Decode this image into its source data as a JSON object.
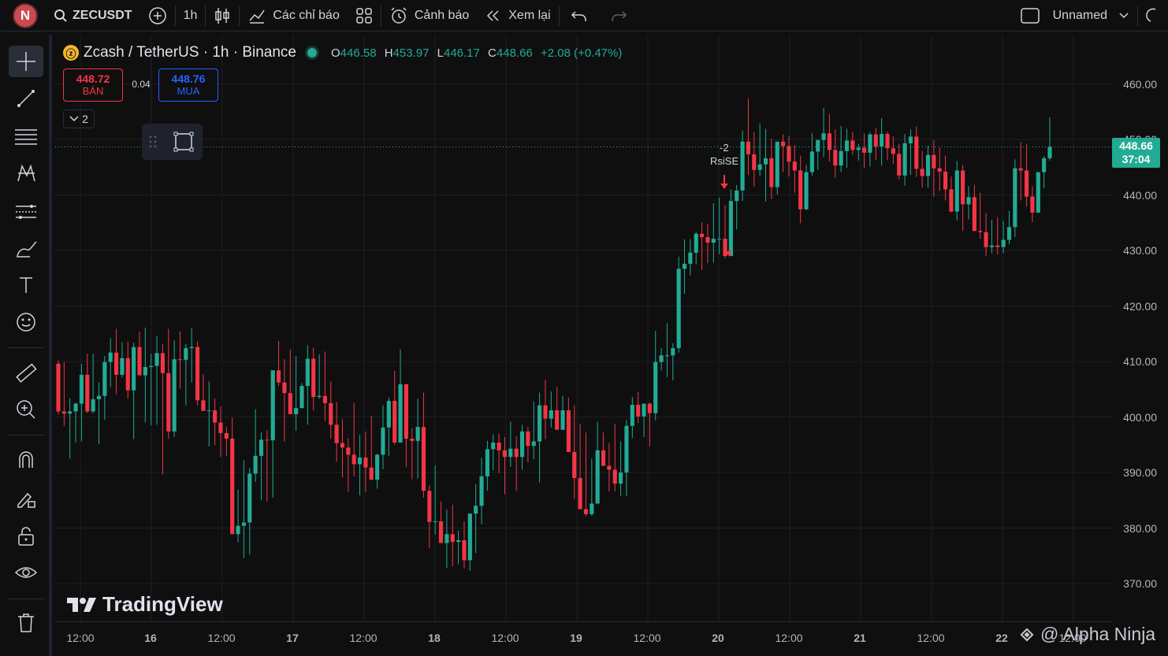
{
  "topbar": {
    "avatar_letter": "N",
    "symbol": "ZECUSDT",
    "interval": "1h",
    "indicators_label": "Các chỉ báo",
    "alerts_label": "Cảnh báo",
    "replay_label": "Xem lại",
    "layout_name": "Unnamed"
  },
  "legend": {
    "title": "Zcash / TetherUS · 1h · Binance",
    "coin_glyph": "ⓩ",
    "o_key": "O",
    "o_val": "446.58",
    "h_key": "H",
    "h_val": "453.97",
    "l_key": "L",
    "l_val": "446.17",
    "c_key": "C",
    "c_val": "448.66",
    "change": "+2.08 (+0.47%)"
  },
  "trade": {
    "sell_price": "448.72",
    "sell_label": "BÁN",
    "spread": "0.04",
    "buy_price": "448.76",
    "buy_label": "MUA",
    "collapse_count": "2"
  },
  "signal": {
    "value": "-2",
    "label": "RsiSE"
  },
  "price_axis": {
    "labels": [
      "460.00",
      "450.00",
      "440.00",
      "430.00",
      "420.00",
      "410.00",
      "400.00",
      "390.00",
      "380.00",
      "370.00"
    ],
    "last_price": "448.66",
    "countdown": "37:04"
  },
  "time_axis": {
    "labels": [
      "12:00",
      "16",
      "12:00",
      "17",
      "12:00",
      "18",
      "12:00",
      "19",
      "12:00",
      "20",
      "12:00",
      "21",
      "12:00",
      "22",
      "12:00"
    ]
  },
  "branding": {
    "logo": "TradingView",
    "watermark": "@ Alpha Ninja"
  },
  "colors": {
    "up": "#22ab94",
    "down": "#f23645",
    "background": "#0f0f0f",
    "grid": "#1c1f26"
  },
  "chart_data": {
    "type": "candlestick",
    "symbol": "ZECUSDT",
    "interval": "1h",
    "ylim": [
      365,
      465
    ],
    "ohlc": [
      [
        409.6,
        410.2,
        400.5,
        401.0
      ],
      [
        401.0,
        409.9,
        398.4,
        400.6
      ],
      [
        400.6,
        403.4,
        392.5,
        401.0
      ],
      [
        401.0,
        402.6,
        395.4,
        402.4
      ],
      [
        402.4,
        409.6,
        395.6,
        407.6
      ],
      [
        407.6,
        411.4,
        400.7,
        401.0
      ],
      [
        401.0,
        411.4,
        400.7,
        403.2
      ],
      [
        403.2,
        406.2,
        395.1,
        403.8
      ],
      [
        403.8,
        411.0,
        399.5,
        409.9
      ],
      [
        409.9,
        414.2,
        405.4,
        411.6
      ],
      [
        411.6,
        415.9,
        404.1,
        407.6
      ],
      [
        407.6,
        413.5,
        407.1,
        410.6
      ],
      [
        410.6,
        413.6,
        403.3,
        404.8
      ],
      [
        404.8,
        413.4,
        396.0,
        412.6
      ],
      [
        412.6,
        415.4,
        407.8,
        407.5
      ],
      [
        407.5,
        416.1,
        399.0,
        409.0
      ],
      [
        409.0,
        411.4,
        398.5,
        409.2
      ],
      [
        409.2,
        414.6,
        398.6,
        411.5
      ],
      [
        411.5,
        413.1,
        389.7,
        407.9
      ],
      [
        407.9,
        415.9,
        396.1,
        397.4
      ],
      [
        397.4,
        413.8,
        396.4,
        410.4
      ],
      [
        410.4,
        415.4,
        405.1,
        410.3
      ],
      [
        410.3,
        413.2,
        402.1,
        412.4
      ],
      [
        412.4,
        416.1,
        406.2,
        412.6
      ],
      [
        412.6,
        413.6,
        402.1,
        403.0
      ],
      [
        403.0,
        407.7,
        401.6,
        401.1
      ],
      [
        401.1,
        406.4,
        394.7,
        401.2
      ],
      [
        401.2,
        403.3,
        394.9,
        399.0
      ],
      [
        399.0,
        401.9,
        392.8,
        397.1
      ],
      [
        397.1,
        398.2,
        393.0,
        396.1
      ],
      [
        396.1,
        399.9,
        384.8,
        378.9
      ],
      [
        378.9,
        386.9,
        377.4,
        380.4
      ],
      [
        380.4,
        392.2,
        374.6,
        381.0
      ],
      [
        381.0,
        390.8,
        375.2,
        389.8
      ],
      [
        389.8,
        401.4,
        388.3,
        393.0
      ],
      [
        393.0,
        397.2,
        385.0,
        395.9
      ],
      [
        395.9,
        397.6,
        384.8,
        395.8
      ],
      [
        395.8,
        405.3,
        385.5,
        408.4
      ],
      [
        408.4,
        413.7,
        405.6,
        406.2
      ],
      [
        406.2,
        410.4,
        395.6,
        404.3
      ],
      [
        404.3,
        412.2,
        405.0,
        400.5
      ],
      [
        400.5,
        411.0,
        397.5,
        401.6
      ],
      [
        401.6,
        406.1,
        403.3,
        405.6
      ],
      [
        405.6,
        412.9,
        398.6,
        410.5
      ],
      [
        410.5,
        412.5,
        401.2,
        403.6
      ],
      [
        403.6,
        411.3,
        403.3,
        403.8
      ],
      [
        403.8,
        411.8,
        399.3,
        402.5
      ],
      [
        402.5,
        406.4,
        396.1,
        398.6
      ],
      [
        398.6,
        402.7,
        392.0,
        395.3
      ],
      [
        395.3,
        399.6,
        389.1,
        394.5
      ],
      [
        394.5,
        396.2,
        386.5,
        393.2
      ],
      [
        393.2,
        402.6,
        389.3,
        391.5
      ],
      [
        391.5,
        396.8,
        385.9,
        392.7
      ],
      [
        392.7,
        397.4,
        386.5,
        390.9
      ],
      [
        390.9,
        400.2,
        388.8,
        388.7
      ],
      [
        388.7,
        393.4,
        387.1,
        393.2
      ],
      [
        393.2,
        402.1,
        390.6,
        398.1
      ],
      [
        398.1,
        403.5,
        393.0,
        402.9
      ],
      [
        402.9,
        408.3,
        395.0,
        395.4
      ],
      [
        395.4,
        412.2,
        395.4,
        405.9
      ],
      [
        405.9,
        405.4,
        391.0,
        396.1
      ],
      [
        396.1,
        398.0,
        388.8,
        395.7
      ],
      [
        395.7,
        403.3,
        388.9,
        398.2
      ],
      [
        398.2,
        404.4,
        385.5,
        386.7
      ],
      [
        386.7,
        387.7,
        376.4,
        381.1
      ],
      [
        381.1,
        391.3,
        378.8,
        381.2
      ],
      [
        381.2,
        384.8,
        377.8,
        377.3
      ],
      [
        377.3,
        383.3,
        372.8,
        378.9
      ],
      [
        378.9,
        384.2,
        373.1,
        377.5
      ],
      [
        377.5,
        379.5,
        373.5,
        377.8
      ],
      [
        377.8,
        381.2,
        372.7,
        374.2
      ],
      [
        374.2,
        381.0,
        372.3,
        382.6
      ],
      [
        382.6,
        387.9,
        375.5,
        384.0
      ],
      [
        384.0,
        392.6,
        380.7,
        389.3
      ],
      [
        389.3,
        395.7,
        386.7,
        394.2
      ],
      [
        394.2,
        396.9,
        390.4,
        395.4
      ],
      [
        395.4,
        397.0,
        389.9,
        394.0
      ],
      [
        394.0,
        396.4,
        386.1,
        392.8
      ],
      [
        392.8,
        399.2,
        391.0,
        394.3
      ],
      [
        394.3,
        396.5,
        386.7,
        392.8
      ],
      [
        392.8,
        398.6,
        390.5,
        397.4
      ],
      [
        397.4,
        398.2,
        391.9,
        394.8
      ],
      [
        394.8,
        402.8,
        392.4,
        395.6
      ],
      [
        395.6,
        404.4,
        388.2,
        402.1
      ],
      [
        402.1,
        406.7,
        396.0,
        399.7
      ],
      [
        399.7,
        404.6,
        398.1,
        401.2
      ],
      [
        401.2,
        405.4,
        398.4,
        397.7
      ],
      [
        397.7,
        403.8,
        398.0,
        401.2
      ],
      [
        401.2,
        403.5,
        396.9,
        393.7
      ],
      [
        393.7,
        402.1,
        385.2,
        389.0
      ],
      [
        389.0,
        398.8,
        384.2,
        383.4
      ],
      [
        383.4,
        397.2,
        382.1,
        382.5
      ],
      [
        382.5,
        392.5,
        382.2,
        384.4
      ],
      [
        384.4,
        399.2,
        384.6,
        394.0
      ],
      [
        394.0,
        397.2,
        391.6,
        391.2
      ],
      [
        391.2,
        395.3,
        386.6,
        390.5
      ],
      [
        390.5,
        398.8,
        386.6,
        388.0
      ],
      [
        388.0,
        395.6,
        385.8,
        390.0
      ],
      [
        390.0,
        399.5,
        385.7,
        398.4
      ],
      [
        398.4,
        403.6,
        396.2,
        402.2
      ],
      [
        402.2,
        404.5,
        398.9,
        400.1
      ],
      [
        400.1,
        400.1,
        396.4,
        402.4
      ],
      [
        402.4,
        402.6,
        394.7,
        400.7
      ],
      [
        400.7,
        415.5,
        399.4,
        409.9
      ],
      [
        409.9,
        412.4,
        408.4,
        411.1
      ],
      [
        411.1,
        416.9,
        407.2,
        411.1
      ],
      [
        411.1,
        413.3,
        406.6,
        412.4
      ],
      [
        412.4,
        428.9,
        411.6,
        426.7
      ],
      [
        426.7,
        432.0,
        422.2,
        427.6
      ],
      [
        427.6,
        432.0,
        425.5,
        429.6
      ],
      [
        429.6,
        433.3,
        427.5,
        433.0
      ],
      [
        433.0,
        435.1,
        426.5,
        432.4
      ],
      [
        432.4,
        434.8,
        427.7,
        431.4
      ],
      [
        431.4,
        438.5,
        427.8,
        432.1
      ],
      [
        432.1,
        439.5,
        429.3,
        432.1
      ],
      [
        432.1,
        438.2,
        428.6,
        429.0
      ],
      [
        429.0,
        441.0,
        431.3,
        438.9
      ],
      [
        438.9,
        441.8,
        433.8,
        440.8
      ],
      [
        440.8,
        451.6,
        438.9,
        449.6
      ],
      [
        449.6,
        457.4,
        443.6,
        447.3
      ],
      [
        447.3,
        451.3,
        441.5,
        444.5
      ],
      [
        444.5,
        452.9,
        443.4,
        445.5
      ],
      [
        445.5,
        451.9,
        438.8,
        446.6
      ],
      [
        446.6,
        450.1,
        439.3,
        441.4
      ],
      [
        441.4,
        449.6,
        440.1,
        449.6
      ],
      [
        449.6,
        450.9,
        444.1,
        448.8
      ],
      [
        448.8,
        450.6,
        443.3,
        446.0
      ],
      [
        446.0,
        449.0,
        440.4,
        444.4
      ],
      [
        444.4,
        447.1,
        434.9,
        437.4
      ],
      [
        437.4,
        445.4,
        437.3,
        444.1
      ],
      [
        444.1,
        451.1,
        443.5,
        447.8
      ],
      [
        447.8,
        449.0,
        444.5,
        449.9
      ],
      [
        449.9,
        455.7,
        446.8,
        451.1
      ],
      [
        451.1,
        454.6,
        446.0,
        448.1
      ],
      [
        448.1,
        451.8,
        443.1,
        445.3
      ],
      [
        445.3,
        452.4,
        444.1,
        447.9
      ],
      [
        447.9,
        451.9,
        444.9,
        449.8
      ],
      [
        449.8,
        451.4,
        447.2,
        448.1
      ],
      [
        448.1,
        449.2,
        446.2,
        448.5
      ],
      [
        448.5,
        451.1,
        444.8,
        447.6
      ],
      [
        447.6,
        451.3,
        445.1,
        450.9
      ],
      [
        450.9,
        452.1,
        446.3,
        448.7
      ],
      [
        448.7,
        453.8,
        445.3,
        451.0
      ],
      [
        451.0,
        451.4,
        446.3,
        448.4
      ],
      [
        448.4,
        450.5,
        445.6,
        447.4
      ],
      [
        447.4,
        449.2,
        442.8,
        443.5
      ],
      [
        443.5,
        451.0,
        441.7,
        449.3
      ],
      [
        449.3,
        451.8,
        443.6,
        450.5
      ],
      [
        450.5,
        452.3,
        443.2,
        444.7
      ],
      [
        444.7,
        447.9,
        441.3,
        443.4
      ],
      [
        443.4,
        448.8,
        441.3,
        447.2
      ],
      [
        447.2,
        449.8,
        439.7,
        444.8
      ],
      [
        444.8,
        448.5,
        440.7,
        444.2
      ],
      [
        444.2,
        447.1,
        439.0,
        441.0
      ],
      [
        441.0,
        443.3,
        436.9,
        437.0
      ],
      [
        437.0,
        446.1,
        435.4,
        444.4
      ],
      [
        444.4,
        445.4,
        433.5,
        438.3
      ],
      [
        438.3,
        441.6,
        435.6,
        439.6
      ],
      [
        439.6,
        441.8,
        434.3,
        433.5
      ],
      [
        433.5,
        440.4,
        432.1,
        433.3
      ],
      [
        433.3,
        436.7,
        429.0,
        430.6
      ],
      [
        430.6,
        435.5,
        429.5,
        430.9
      ],
      [
        430.9,
        436.0,
        429.3,
        430.6
      ],
      [
        430.6,
        435.3,
        429.5,
        431.9
      ],
      [
        431.9,
        437.1,
        431.1,
        434.2
      ],
      [
        434.2,
        446.4,
        432.4,
        444.8
      ],
      [
        444.8,
        449.5,
        439.0,
        444.4
      ],
      [
        444.4,
        449.2,
        437.9,
        439.7
      ],
      [
        439.7,
        441.6,
        435.1,
        436.8
      ],
      [
        436.8,
        442.9,
        438.7,
        444.1
      ],
      [
        444.1,
        447.0,
        441.2,
        446.6
      ],
      [
        446.6,
        453.97,
        446.17,
        448.66
      ]
    ]
  }
}
